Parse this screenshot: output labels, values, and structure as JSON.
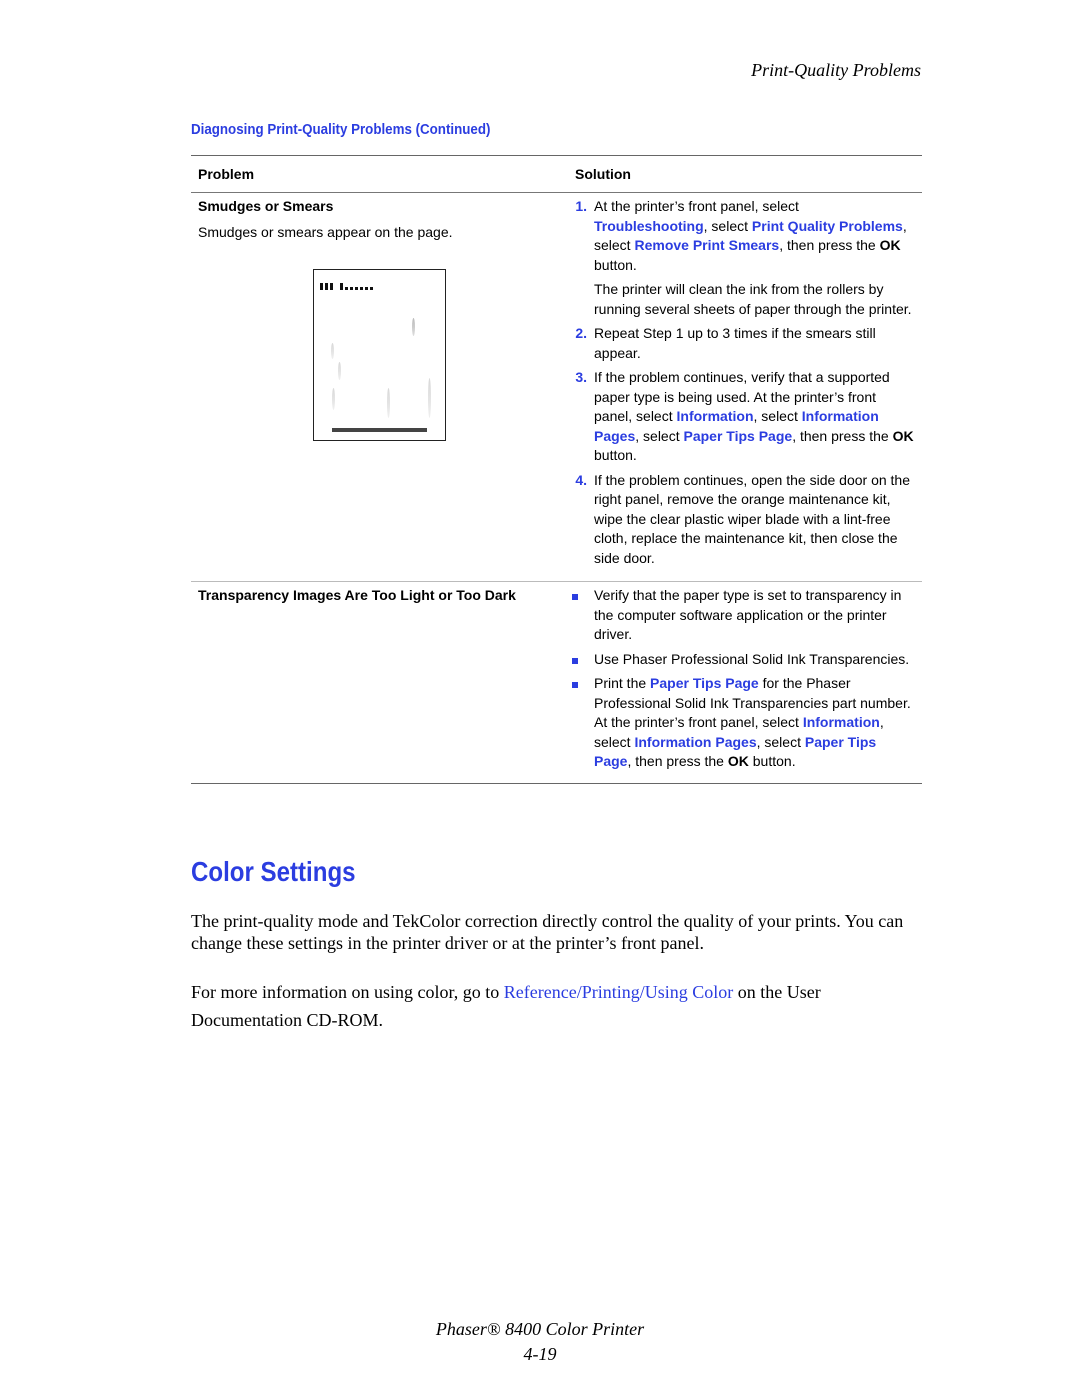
{
  "running_head": "Print-Quality Problems",
  "table": {
    "title": "Diagnosing Print-Quality Problems (Continued)",
    "headers": {
      "problem": "Problem",
      "solution": "Solution"
    },
    "rows": [
      {
        "problem_title": "Smudges or Smears",
        "problem_desc": "Smudges or smears appear on the page.",
        "illustration": "smudged-page-illustration",
        "steps": [
          {
            "num": "1.",
            "parts": [
              {
                "t": "At the printer’s front panel, select "
              },
              {
                "t": "Troubleshooting",
                "link": true
              },
              {
                "t": ", select "
              },
              {
                "t": "Print Quality Problems",
                "link": true
              },
              {
                "t": ", select "
              },
              {
                "t": "Remove Print Smears",
                "link": true
              },
              {
                "t": ", then press the "
              },
              {
                "t": "OK",
                "bold": true
              },
              {
                "t": " button."
              }
            ],
            "note": "The printer will clean the ink from the rollers by running several sheets of paper through the printer."
          },
          {
            "num": "2.",
            "parts": [
              {
                "t": "Repeat Step 1 up to 3 times if the smears still appear."
              }
            ]
          },
          {
            "num": "3.",
            "parts": [
              {
                "t": "If the problem continues, verify that a supported paper type is being used. At the printer’s front panel, select "
              },
              {
                "t": "Information",
                "link": true
              },
              {
                "t": ", select "
              },
              {
                "t": "Information Pages",
                "link": true
              },
              {
                "t": ", select "
              },
              {
                "t": "Paper Tips Page",
                "link": true
              },
              {
                "t": ", then press the "
              },
              {
                "t": "OK",
                "bold": true
              },
              {
                "t": " button."
              }
            ]
          },
          {
            "num": "4.",
            "parts": [
              {
                "t": "If the problem continues, open the side door on the right panel, remove the orange maintenance kit, wipe the clear plastic wiper blade with a lint-free cloth, replace the maintenance kit, then close the side door."
              }
            ]
          }
        ]
      },
      {
        "problem_title": "Transparency Images Are Too Light or Too Dark",
        "bullets": [
          {
            "parts": [
              {
                "t": "Verify that the paper type is set to transparency in the computer software application or the printer driver."
              }
            ]
          },
          {
            "parts": [
              {
                "t": "Use Phaser Professional Solid Ink Transparencies."
              }
            ]
          },
          {
            "parts": [
              {
                "t": "Print the "
              },
              {
                "t": "Paper Tips Page",
                "link": true
              },
              {
                "t": " for the Phaser Professional Solid Ink Transparencies part number. At the printer’s front panel, select "
              },
              {
                "t": "Information",
                "link": true
              },
              {
                "t": ", select "
              },
              {
                "t": "Information Pages",
                "link": true
              },
              {
                "t": ", select "
              },
              {
                "t": "Paper Tips Page",
                "link": true
              },
              {
                "t": ", then press the "
              },
              {
                "t": "OK",
                "bold": true
              },
              {
                "t": " button."
              }
            ]
          }
        ]
      }
    ]
  },
  "section": {
    "title": "Color Settings",
    "para1": "The print-quality mode and TekColor correction directly control the quality of your prints. You can change these settings in the printer driver or at the printer’s front panel.",
    "para2_before": "For more information on using color, go to ",
    "para2_link": "Reference/Printing/Using Color",
    "para2_after": " on the User Documentation CD-ROM."
  },
  "footer": {
    "product": "Phaser® 8400 Color Printer",
    "page": "4-19"
  },
  "colors": {
    "accent": "#2b3de0",
    "rule": "#666666"
  }
}
